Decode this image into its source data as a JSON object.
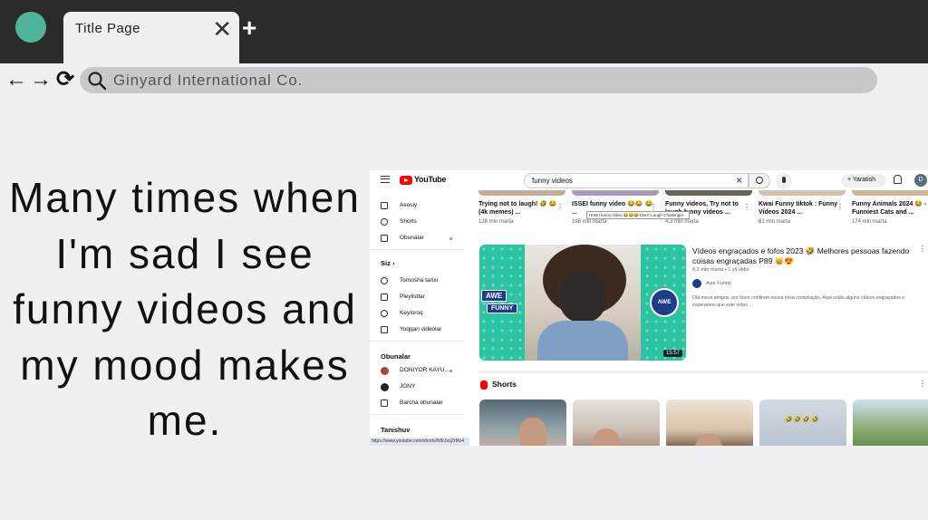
{
  "browser": {
    "tab_title": "Title Page",
    "tab_close_icon": "✕",
    "new_tab_icon": "+",
    "back_icon": "←",
    "forward_icon": "→",
    "reload_icon": "⟳",
    "address_text": "Ginyard International Co.",
    "accent_color": "#4fb59a"
  },
  "slide": {
    "text": "Many times when I'm sad I see funny videos and my mood makes me."
  },
  "youtube": {
    "logo_text": "YouTube",
    "search_value": "funny videos",
    "create_label": "Yaratish",
    "avatar_letter": "D",
    "sidebar": {
      "items": [
        {
          "label": "Asosiy"
        },
        {
          "label": "Shorts"
        },
        {
          "label": "Obunalar"
        }
      ],
      "you_header": "Siz",
      "you_items": [
        {
          "label": "Tomosha tarixi"
        },
        {
          "label": "Pleylistlar"
        },
        {
          "label": "Keyinroq"
        },
        {
          "label": "Yoqqan videolar"
        }
      ],
      "subs_header": "Obunalar",
      "subs_items": [
        {
          "label": "DONIYOR KAYU..."
        },
        {
          "label": "JONY"
        },
        {
          "label": "Barcha obunalar"
        }
      ],
      "explore_header": "Tanishuv",
      "status_url": "https://www.youtube.com/shorts/N9rJxqZrMz4"
    },
    "top_videos": [
      {
        "title": "Trying not to laugh! 🤣 😂 (4k memes) ...",
        "meta": "128 mln marta"
      },
      {
        "title": "ISSEI funny video 😂😂 😂 ...",
        "meta": "198 mln marta"
      },
      {
        "title": "Funny videos, Try not to laugh funny videos ...",
        "meta": "4,3 mln marta"
      },
      {
        "title": "Kwai Funny tiktok : Funny Videos 2024 ...",
        "meta": "81 mln marta"
      },
      {
        "title": "Funny Animals 2024 😂 - Funniest Cats and ...",
        "meta": "174 mln marta"
      }
    ],
    "tooltip": "ISSEI funny video 😂😂😂 Don't Laugh Challenge!",
    "featured": {
      "title": "Vídeos engraçados e fofos 2023 🤣 Melhores pessoas fazendo coisas engraçadas P89 😸😍",
      "meta": "6,2 mln marta • 1 yil oldin",
      "channel": "Awe Funny",
      "description": "Olá meus amigos, por favor confiram nossa nova compilação. Aqui estão alguns vídeos engraçados e esperamos que este vídeo ...",
      "duration": "15:57",
      "badge_top": "AWE",
      "badge_bottom": "FUNNY",
      "badge_round": "AWE"
    },
    "shorts_title": "Shorts",
    "short_emoji": "🤣🤣🤣🤣"
  }
}
